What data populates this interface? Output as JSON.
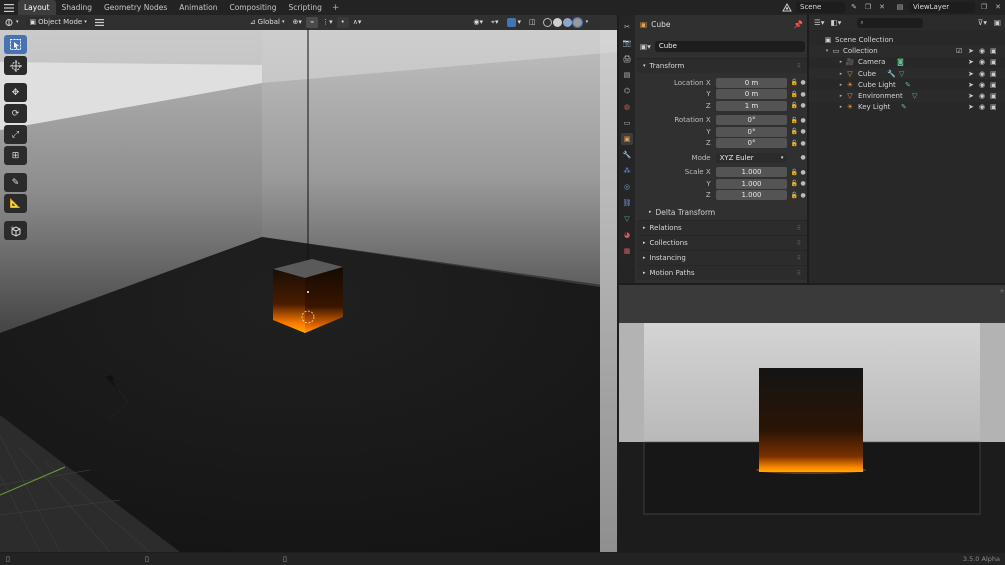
{
  "topbar": {
    "tabs": [
      "Layout",
      "Shading",
      "Geometry Nodes",
      "Animation",
      "Compositing",
      "Scripting"
    ],
    "add_tab": "+",
    "scene": "Scene",
    "view_layer": "ViewLayer"
  },
  "viewport": {
    "mode": "Object Mode",
    "orientation": "Global"
  },
  "properties": {
    "breadcrumb": "Cube",
    "object_name": "Cube",
    "transform_header": "Transform",
    "location_label": "Location X",
    "rotation_label": "Rotation X",
    "mode_label": "Mode",
    "scale_label": "Scale X",
    "axis_y": "Y",
    "axis_z": "Z",
    "location": [
      "0 m",
      "0 m",
      "1 m"
    ],
    "rotation": [
      "0°",
      "0°",
      "0°"
    ],
    "rotation_mode": "XYZ Euler",
    "scale": [
      "1.000",
      "1.000",
      "1.000"
    ],
    "delta_transform": "Delta Transform",
    "panels": [
      "Relations",
      "Collections",
      "Instancing",
      "Motion Paths"
    ]
  },
  "outliner": {
    "scene_collection": "Scene Collection",
    "collection": "Collection",
    "objects": [
      "Camera",
      "Cube",
      "Cube Light",
      "Environment",
      "Key Light"
    ]
  },
  "status": {
    "version": "3.5.0 Alpha"
  },
  "colors": {
    "accent": "#4772b3",
    "glow": "#ff7a00",
    "object_orange": "#e8a04b",
    "data_green": "#5fbf8a"
  }
}
